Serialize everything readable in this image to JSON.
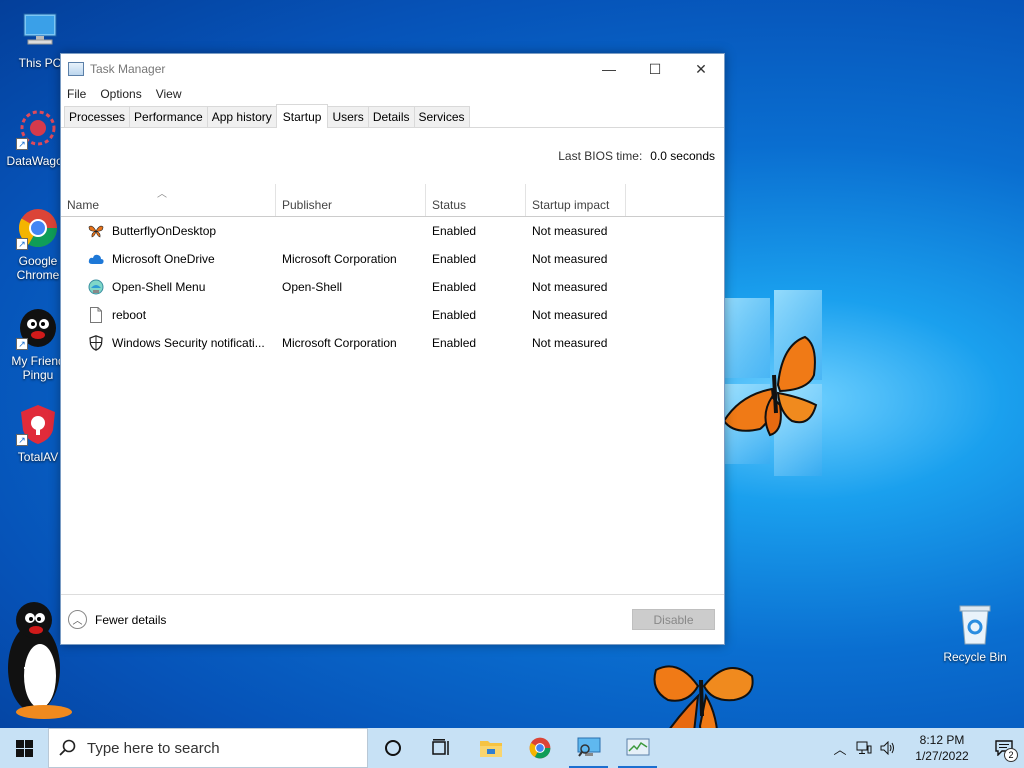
{
  "desktop": {
    "icons": [
      {
        "label": "This PC"
      },
      {
        "label": "DataWagon"
      },
      {
        "label": "Google Chrome"
      },
      {
        "label": "My Friend Pingu"
      },
      {
        "label": "TotalAV"
      },
      {
        "label": "Recycle Bin"
      }
    ]
  },
  "window": {
    "title": "Task Manager",
    "menu": [
      "File",
      "Options",
      "View"
    ],
    "tabs": [
      "Processes",
      "Performance",
      "App history",
      "Startup",
      "Users",
      "Details",
      "Services"
    ],
    "active_tab": "Startup",
    "bios_label": "Last BIOS time:",
    "bios_value": "0.0 seconds",
    "columns": [
      "Name",
      "Publisher",
      "Status",
      "Startup impact"
    ],
    "rows": [
      {
        "name": "ButterflyOnDesktop",
        "publisher": "",
        "status": "Enabled",
        "impact": "Not measured",
        "icon": "butterfly-icon"
      },
      {
        "name": "Microsoft OneDrive",
        "publisher": "Microsoft Corporation",
        "status": "Enabled",
        "impact": "Not measured",
        "icon": "cloud-icon"
      },
      {
        "name": "Open-Shell Menu",
        "publisher": "Open-Shell",
        "status": "Enabled",
        "impact": "Not measured",
        "icon": "shell-icon"
      },
      {
        "name": "reboot",
        "publisher": "",
        "status": "Enabled",
        "impact": "Not measured",
        "icon": "file-icon"
      },
      {
        "name": "Windows Security notificati...",
        "publisher": "Microsoft Corporation",
        "status": "Enabled",
        "impact": "Not measured",
        "icon": "shield-icon"
      }
    ],
    "footer": {
      "fewer_details": "Fewer details",
      "disable": "Disable"
    }
  },
  "taskbar": {
    "search_placeholder": "Type here to search",
    "time": "8:12 PM",
    "date": "1/27/2022",
    "notification_count": "2"
  }
}
